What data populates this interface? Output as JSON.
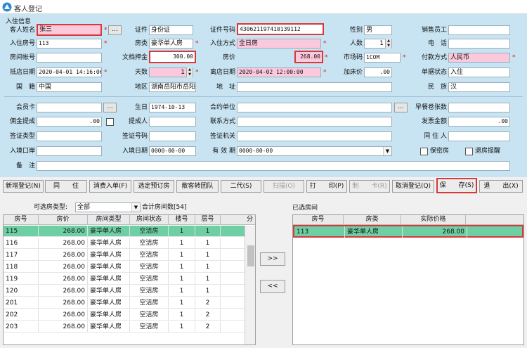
{
  "window": {
    "title": "客人登记"
  },
  "section": {
    "title": "入住信息"
  },
  "labels": {
    "guest_name": "客人姓名",
    "id_type": "证件",
    "id_number": "证件号码",
    "gender": "性别",
    "salesperson": "销售员工",
    "room_no": "入住房号",
    "room_type": "房类",
    "checkin_method": "入住方式",
    "headcount": "人数",
    "phone": "电　话",
    "room_account": "房间帐号",
    "deposit": "文档押金",
    "room_price": "房价",
    "market_code": "市场码",
    "payment_method": "付款方式",
    "arrival_date": "抵店日期",
    "days": "天数",
    "departure_date": "离店日期",
    "surcharge": "加床价",
    "bill_status": "单据状态",
    "nationality": "国　籍",
    "region": "地区",
    "address": "地　址",
    "ethnicity": "民　族",
    "member_card": "会员卡",
    "birthday": "生日",
    "contract_unit": "合约单位",
    "breakfast_tickets": "早餐卷张数",
    "commission": "佣金提成",
    "referrer": "提成人",
    "contact_method": "联系方式",
    "invoice_amount": "发票金额",
    "visa_type": "签证类型",
    "visa_no": "签证号码",
    "visa_office": "签证机关",
    "co_resident": "同 住 人",
    "entry_port": "入境口岸",
    "entry_date": "入境日期",
    "valid_until": "有 效 期",
    "keep_secret": "保密房",
    "checkout_reminder": "退房提醒",
    "remark": "备　注"
  },
  "values": {
    "guest_name": "张三",
    "id_type": "身份证",
    "id_number": "430621197410139112",
    "gender": "男",
    "salesperson": "",
    "room_no": "113",
    "room_type": "豪华单人房",
    "checkin_method": "全日房",
    "headcount": "1",
    "phone": "",
    "room_account": "",
    "deposit": "300.00",
    "room_price": "268.00",
    "market_code": "1COM",
    "payment_method": "人民币",
    "arrival_date": "2020-04-01 14:16:06",
    "days": "1",
    "departure_date": "2020-04-02 12:00:00",
    "surcharge": ".00",
    "bill_status": "入住",
    "nationality": "中国",
    "region": "湖南岳阳市岳阳",
    "address": "",
    "ethnicity": "汉",
    "member_card": "",
    "birthday": "1974-10-13",
    "contract_unit": "",
    "breakfast_tickets": "",
    "commission": ".00",
    "referrer": "",
    "contact_method": "",
    "invoice_amount": ".00",
    "visa_type": "",
    "visa_no": "",
    "visa_office": "",
    "co_resident": "",
    "entry_port": "",
    "entry_date": "0000-00-00",
    "valid_until": "0000-00-00",
    "remark": ""
  },
  "buttons": {
    "ellipsis": "...",
    "new_checkin": "新增登记(N)",
    "cohabit": "同　　住",
    "consume": "消费入单(F)",
    "select_booking": "选定预订房",
    "to_group": "散客转团队",
    "second_gen": "二代(S)",
    "scan": "扫描(O)",
    "print": "打　　印(P)",
    "make_card": "制　　卡(R)",
    "cancel_checkin": "取消登记(Q)",
    "save": "保　　存(S)",
    "exit": "退　　出(X)",
    "move_right": ">>",
    "move_left": "<<"
  },
  "left_panel": {
    "filter_label": "可选房类型:",
    "filter_value": "全部",
    "total_label": "合计房间数[54]",
    "columns": [
      "房号",
      "房价",
      "房间类型",
      "房间状态",
      "楼号",
      "层号",
      "分"
    ],
    "rows": [
      [
        "115",
        "268.00",
        "豪华单人房",
        "空洁房",
        "1",
        "1"
      ],
      [
        "116",
        "268.00",
        "豪华单人房",
        "空洁房",
        "1",
        "1"
      ],
      [
        "117",
        "268.00",
        "豪华单人房",
        "空洁房",
        "1",
        "1"
      ],
      [
        "118",
        "268.00",
        "豪华单人房",
        "空洁房",
        "1",
        "1"
      ],
      [
        "119",
        "268.00",
        "豪华单人房",
        "空洁房",
        "1",
        "1"
      ],
      [
        "120",
        "268.00",
        "豪华单人房",
        "空洁房",
        "1",
        "1"
      ],
      [
        "201",
        "268.00",
        "豪华单人房",
        "空洁房",
        "1",
        "2"
      ],
      [
        "202",
        "268.00",
        "豪华单人房",
        "空洁房",
        "1",
        "2"
      ],
      [
        "203",
        "268.00",
        "豪华单人房",
        "空洁房",
        "1",
        "2"
      ]
    ]
  },
  "right_panel": {
    "title": "已选房间",
    "columns": [
      "房号",
      "房类",
      "实际价格"
    ],
    "rows": [
      [
        "113",
        "豪华单人房",
        "268.00"
      ]
    ]
  },
  "colors": {
    "panel_bg": "#c8e4f2",
    "required_bg": "#fcc8dc",
    "highlight": "#d83838",
    "selected_row": "#6fcfa4"
  }
}
